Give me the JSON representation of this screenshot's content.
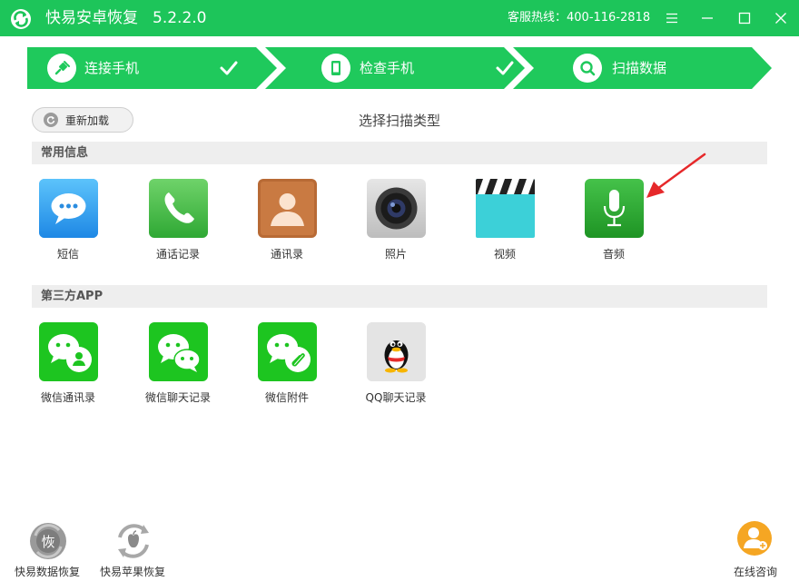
{
  "app": {
    "title": "快易安卓恢复",
    "version": "5.2.2.0",
    "hotline": "客服热线：400-116-2818"
  },
  "window_controls": [
    "menu-icon",
    "minimize-icon",
    "maximize-icon",
    "close-icon"
  ],
  "steps": [
    {
      "label": "连接手机",
      "icon": "plug-icon",
      "done": true
    },
    {
      "label": "检查手机",
      "icon": "phone-icon",
      "done": true
    },
    {
      "label": "扫描数据",
      "icon": "magnifier-icon",
      "done": false
    }
  ],
  "toolbar": {
    "reload_label": "重新加载",
    "scan_type_title": "选择扫描类型"
  },
  "sections": {
    "common": {
      "title": "常用信息",
      "items": [
        {
          "label": "短信",
          "icon": "sms-icon"
        },
        {
          "label": "通话记录",
          "icon": "call-log-icon"
        },
        {
          "label": "通讯录",
          "icon": "contacts-icon"
        },
        {
          "label": "照片",
          "icon": "camera-icon"
        },
        {
          "label": "视频",
          "icon": "video-icon"
        },
        {
          "label": "音频",
          "icon": "microphone-icon"
        }
      ]
    },
    "third_party": {
      "title": "第三方APP",
      "items": [
        {
          "label": "微信通讯录",
          "icon": "wechat-contacts-icon"
        },
        {
          "label": "微信聊天记录",
          "icon": "wechat-chat-icon"
        },
        {
          "label": "微信附件",
          "icon": "wechat-attachment-icon"
        },
        {
          "label": "QQ聊天记录",
          "icon": "qq-icon"
        }
      ]
    }
  },
  "bottom": {
    "data_recovery": {
      "label": "快易数据恢复",
      "icon_text": "恢"
    },
    "apple_recovery": {
      "label": "快易苹果恢复"
    },
    "consult": {
      "label": "在线咨询"
    }
  },
  "colors": {
    "brand_green": "#1dc55a",
    "step_green": "#1fc95c",
    "accent_red": "#e6282a",
    "consult_orange": "#f5a623"
  }
}
